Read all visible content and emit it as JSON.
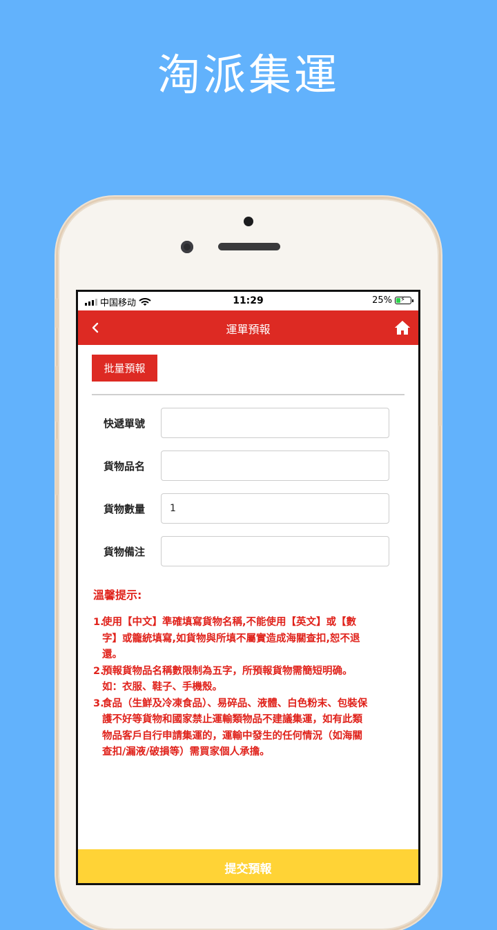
{
  "promo": {
    "title": "淘派集運"
  },
  "status_bar": {
    "carrier": "中国移动",
    "time": "11:29",
    "battery": "25%",
    "battery_level": 0.25
  },
  "navbar": {
    "title": "運單預報",
    "back_icon": "chevron-left-icon",
    "home_icon": "home-icon"
  },
  "batch_button": {
    "label": "批量預報"
  },
  "form": {
    "fields": [
      {
        "label": "快遞單號",
        "value": ""
      },
      {
        "label": "貨物品名",
        "value": ""
      },
      {
        "label": "貨物數量",
        "value": "1"
      },
      {
        "label": "貨物備注",
        "value": ""
      }
    ]
  },
  "tips": {
    "title": "溫馨提示:",
    "items": [
      {
        "num": "1.",
        "text": "使用【中文】準確填寫貨物名稱,不能使用【英文】或【數字】或籠統填寫,如貨物與所填不屬實造成海關查扣,恕不退還。"
      },
      {
        "num": "2.",
        "text": "預報貨物品名稱數限制為五字，所預報貨物需簡短明确。如：衣服、鞋子、手機殼。"
      },
      {
        "num": "3.",
        "text": "食品（生鮮及冷凍食品）、易碎品、液體、白色粉末、包裝保護不好等貨物和國家禁止運輸類物品不建議集運，如有此類物品客戶自行申請集運的，運輸中發生的任何情況（如海關查扣/漏液/破損等）需買家個人承擔。"
      }
    ]
  },
  "submit": {
    "label": "提交預報"
  },
  "colors": {
    "background": "#62b2fc",
    "accent": "#dd2a23",
    "submit": "#ffd336",
    "tips": "#e0221b"
  }
}
